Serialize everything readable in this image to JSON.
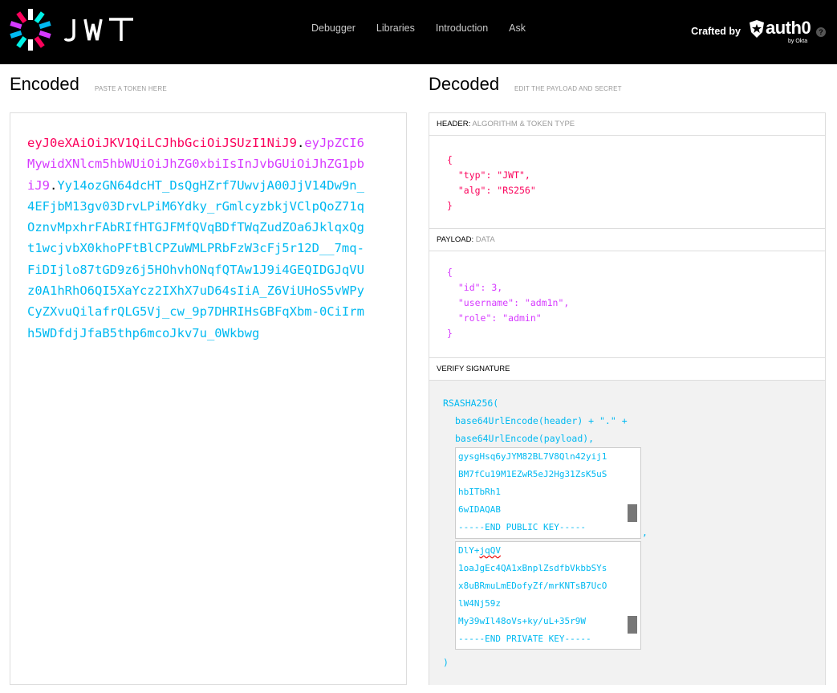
{
  "nav": {
    "items": [
      "Debugger",
      "Libraries",
      "Introduction",
      "Ask"
    ],
    "crafted_by": "Crafted by",
    "brand": "auth0",
    "brand_sub": "by Okta",
    "help": "?"
  },
  "encoded": {
    "title": "Encoded",
    "subtitle": "PASTE A TOKEN HERE",
    "token_header": "eyJ0eXAiOiJKV1QiLCJhbGciOiJSUzI1NiJ9",
    "token_payload": "eyJpZCI6MywidXNlcm5hbWUiOiJhZG0xbiIsInJvbGUiOiJhZG1pbiJ9",
    "token_signature": "Yy14ozGN64dcHT_DsQgHZrf7UwvjA00JjV14Dw9n_4EFjbM13gv03DrvLPiM6Ydky_rGmlcyzbkjVClpQoZ71qOznvMpxhrFAbRIfHTGJFMfQVqBDfTWqZudZOa6JklqxQgt1wcjvbX0khoPFtBlCPZuWMLPRbFzW3cFj5r12D__7mq-FiDIjlo87tGD9z6j5HOhvhONqfQTAw1J9i4GEQIDGJqVUz0A1hRhO6QI5XaYcz2IXhX7uD64sIiA_Z6ViUHoS5vWPyCyZXvuQilafrQLG5Vj_cw_9p7DHRIHsGBFqXbm-0CiIrmh5WDfdjJfaB5thp6mcoJkv7u_0Wkbwg",
    "dot": "."
  },
  "decoded": {
    "title": "Decoded",
    "subtitle": "EDIT THE PAYLOAD AND SECRET",
    "header_label": "HEADER:",
    "header_sub": "ALGORITHM & TOKEN TYPE",
    "header_json": "{\n  \"typ\": \"JWT\",\n  \"alg\": \"RS256\"\n}",
    "payload_label": "PAYLOAD:",
    "payload_sub": "DATA",
    "payload_json": "{\n  \"id\": 3,\n  \"username\": \"adm1n\",\n  \"role\": \"admin\"\n}",
    "verify_label": "VERIFY SIGNATURE",
    "verify_fn": "RSASHA256(",
    "verify_line1": "base64UrlEncode(header) + \".\" +",
    "verify_line2": "base64UrlEncode(payload),",
    "comma": ",",
    "close_paren": ")",
    "public_key_lines": [
      "gysgHsq6yJYM82BL7V8Qln42yij1",
      "BM7fCu19M1EZwR5eJ2Hg31ZsK5uS",
      "hbITbRh1",
      "6wIDAQAB",
      "-----END PUBLIC KEY-----"
    ],
    "private_key_lines": [
      "DlY+jqQV",
      "1oaJgEc4QA1xBnplZsdfbVkbbSYs",
      "x8uBRmuLmEDofyZf/mrKNTsB7UcO",
      "lW4Nj59z",
      "My39wIl48oVs+ky/uL+35r9W",
      "-----END PRIVATE KEY-----"
    ]
  }
}
